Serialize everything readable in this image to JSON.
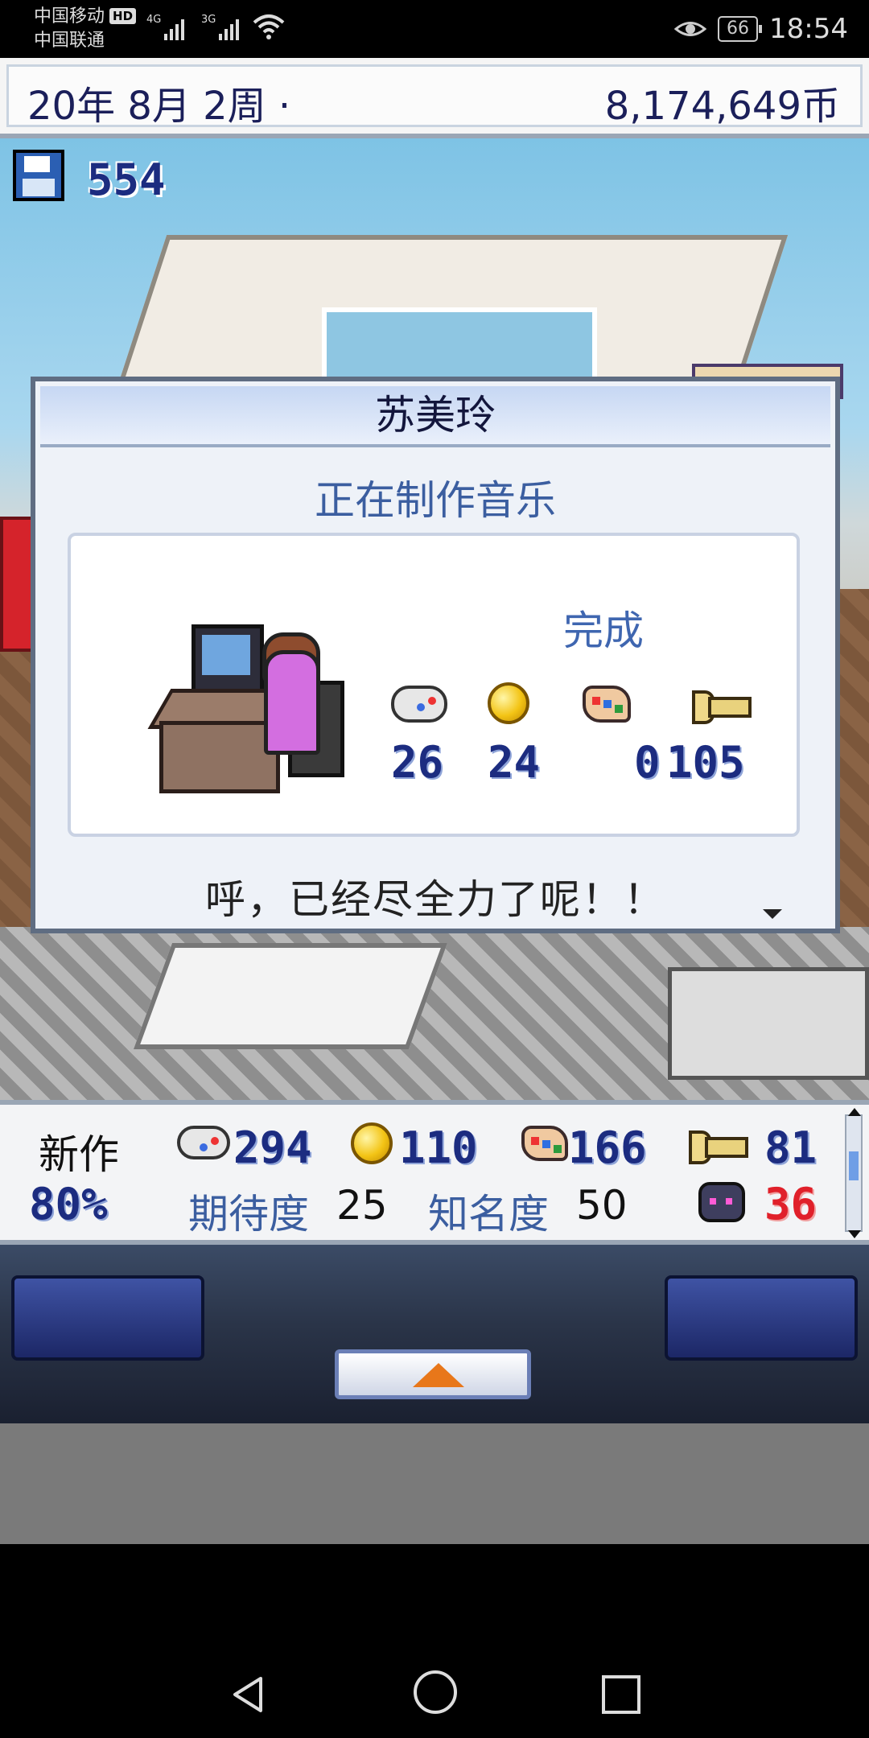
{
  "status_bar": {
    "carrier1": "中国移动",
    "carrier1_badge": "HD",
    "network1": "4G",
    "carrier2": "中国联通",
    "network2": "3G",
    "battery": "66",
    "time": "18:54"
  },
  "header": {
    "date": "20年 8月 2周 ·",
    "money": "8,174,649币"
  },
  "save": {
    "count": "554"
  },
  "dialog": {
    "name": "苏美玲",
    "activity": "正在制作音乐",
    "status": "完成",
    "stats": [
      {
        "icon": "gamepad-icon",
        "value": "26"
      },
      {
        "icon": "coin-icon",
        "value": "24"
      },
      {
        "icon": "palette-icon",
        "value": "0"
      },
      {
        "icon": "trumpet-icon",
        "value": "105"
      }
    ],
    "message": "呼，已经尽全力了呢！！"
  },
  "panel": {
    "new_label": "新作",
    "progress": "80%",
    "fun": "294",
    "creativity": "110",
    "graphics": "166",
    "sound": "81",
    "expectation_label": "期待度",
    "expectation_value": "25",
    "fame_label": "知名度",
    "fame_value": "50",
    "bugs": "36"
  },
  "colors": {
    "accent_blue": "#1c2c80",
    "label_blue": "#3b5ea0",
    "bug_red": "#e0202a"
  }
}
